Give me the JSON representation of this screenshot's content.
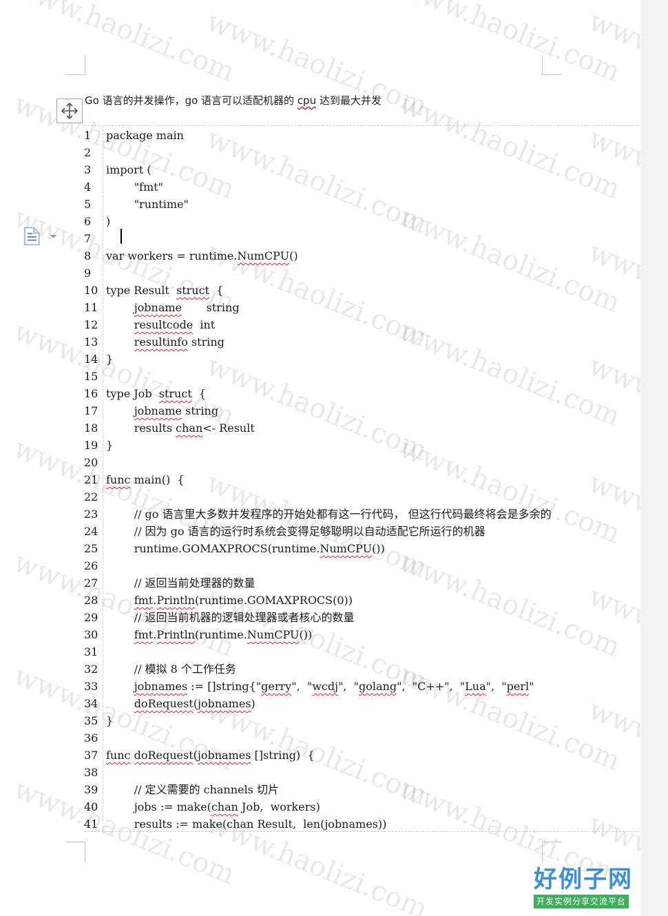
{
  "document": {
    "title_segments": [
      {
        "text": "Go 语言的并发操作，go 语言可以适配机器的 ",
        "sq": false
      },
      {
        "text": "cpu",
        "sq": true
      },
      {
        "text": " 达到最大并发",
        "sq": false
      }
    ],
    "code_lines": [
      [
        {
          "t": "package main"
        }
      ],
      [],
      [
        {
          "t": "import ("
        }
      ],
      [
        {
          "t": "        \"fmt\""
        }
      ],
      [
        {
          "t": "        \"runtime\""
        }
      ],
      [
        {
          "t": ")"
        }
      ],
      [],
      [
        {
          "t": "var workers = runtime."
        },
        {
          "t": "NumCPU",
          "sq": true
        },
        {
          "t": "()"
        }
      ],
      [],
      [
        {
          "t": "type Result  "
        },
        {
          "t": "struct",
          "sq": true
        },
        {
          "t": "  {"
        }
      ],
      [
        {
          "t": "        "
        },
        {
          "t": "jobname",
          "sq": true
        },
        {
          "t": "       string"
        }
      ],
      [
        {
          "t": "        "
        },
        {
          "t": "resultcode",
          "sq": true
        },
        {
          "t": "  int"
        }
      ],
      [
        {
          "t": "        "
        },
        {
          "t": "resultinfo",
          "sq": true
        },
        {
          "t": " string"
        }
      ],
      [
        {
          "t": "}"
        }
      ],
      [],
      [
        {
          "t": "type Job  "
        },
        {
          "t": "struct",
          "sq": true
        },
        {
          "t": "  {"
        }
      ],
      [
        {
          "t": "        "
        },
        {
          "t": "jobname",
          "sq": true
        },
        {
          "t": " string"
        }
      ],
      [
        {
          "t": "        results "
        },
        {
          "t": "chan",
          "sq": true
        },
        {
          "t": "<- Result"
        }
      ],
      [
        {
          "t": "}"
        }
      ],
      [],
      [
        {
          "t": "func",
          "sq": true
        },
        {
          "t": " main()  {"
        }
      ],
      [],
      [
        {
          "t": "        // go 语言里大多数并发程序的开始处都有这一行代码， 但这行代码最终将会是多余的"
        }
      ],
      [
        {
          "t": "        // 因为 go 语言的运行时系统会变得足够聪明以自动适配它所运行的机器"
        }
      ],
      [
        {
          "t": "        runtime.GOMAXPROCS(runtime."
        },
        {
          "t": "NumCPU",
          "sq": true
        },
        {
          "t": "())"
        }
      ],
      [],
      [
        {
          "t": "        // 返回当前处理器的数量"
        }
      ],
      [
        {
          "t": "        "
        },
        {
          "t": "fmt",
          "sq": true
        },
        {
          "t": "."
        },
        {
          "t": "Println",
          "sq": true
        },
        {
          "t": "(runtime.GOMAXPROCS(0))"
        }
      ],
      [
        {
          "t": "        // 返回当前机器的逻辑处理器或者核心的数量"
        }
      ],
      [
        {
          "t": "        "
        },
        {
          "t": "fmt",
          "sq": true
        },
        {
          "t": "."
        },
        {
          "t": "Println",
          "sq": true
        },
        {
          "t": "(runtime."
        },
        {
          "t": "NumCPU",
          "sq": true
        },
        {
          "t": "())"
        }
      ],
      [],
      [
        {
          "t": "        // 模拟 8 个工作任务"
        }
      ],
      [
        {
          "t": "        "
        },
        {
          "t": "jobnames",
          "sq": true
        },
        {
          "t": " := []string{\""
        },
        {
          "t": "gerry",
          "sq": true
        },
        {
          "t": "\",  \""
        },
        {
          "t": "wcdj",
          "sq": true
        },
        {
          "t": "\",  \""
        },
        {
          "t": "golang",
          "sq": true
        },
        {
          "t": "\",  \"C++\",  \""
        },
        {
          "t": "Lua",
          "sq": true
        },
        {
          "t": "\",  \""
        },
        {
          "t": "perl",
          "sq": true
        },
        {
          "t": "\""
        }
      ],
      [
        {
          "t": "        "
        },
        {
          "t": "doRequest",
          "sq": true
        },
        {
          "t": "("
        },
        {
          "t": "jobnames",
          "sq": true
        },
        {
          "t": ")"
        }
      ],
      [
        {
          "t": "}"
        }
      ],
      [],
      [
        {
          "t": "func",
          "sq": true
        },
        {
          "t": " "
        },
        {
          "t": "doRequest",
          "sq": true
        },
        {
          "t": "("
        },
        {
          "t": "jobnames",
          "sq": true
        },
        {
          "t": " []string)  {"
        }
      ],
      [],
      [
        {
          "t": "        // 定义需要的 channels 切片"
        }
      ],
      [
        {
          "t": "        jobs := make("
        },
        {
          "t": "chan",
          "sq": true
        },
        {
          "t": " Job,  workers)"
        }
      ],
      [
        {
          "t": "        results := make("
        },
        {
          "t": "chan",
          "sq": true
        },
        {
          "t": " Result,  "
        },
        {
          "t": "len",
          "sq": true
        },
        {
          "t": "("
        },
        {
          "t": "jobnames",
          "sq": true
        },
        {
          "t": "))"
        }
      ]
    ]
  },
  "watermark": {
    "text": "www.haolizi.com"
  },
  "logo": {
    "main": "好例子网",
    "sub": "开发实例分享交流平台"
  },
  "icons": {
    "move": "move-arrows-icon",
    "doc_float": "document-icon",
    "dropdown": "chevron-down-icon"
  },
  "colors": {
    "spellcheck": "#dd2233",
    "logo_blue": "#3a8fe0",
    "logo_green": "#3fae5a"
  }
}
